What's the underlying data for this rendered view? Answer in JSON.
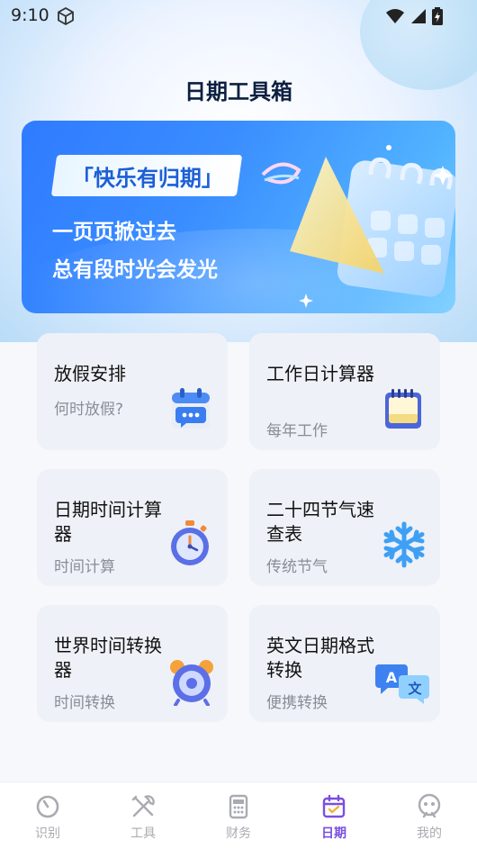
{
  "status": {
    "time": "9:10"
  },
  "header": {
    "title": "日期工具箱"
  },
  "banner": {
    "tag": "「快乐有归期」",
    "line1": "一页页掀过去",
    "line2": "总有段时光会发光"
  },
  "tools": [
    {
      "title": "放假安排",
      "subtitle": "何时放假?",
      "icon": "calendar-chat-icon"
    },
    {
      "title": "工作日计算器",
      "subtitle": "每年工作",
      "icon": "desk-calendar-icon"
    },
    {
      "title": "日期时间计算器",
      "subtitle": "时间计算",
      "icon": "stopwatch-icon"
    },
    {
      "title": "二十四节气速查表",
      "subtitle": "传统节气",
      "icon": "snowflake-icon"
    },
    {
      "title": "世界时间转换器",
      "subtitle": "时间转换",
      "icon": "alarm-clock-icon"
    },
    {
      "title": "英文日期格式转换",
      "subtitle": "便携转换",
      "icon": "translate-icon"
    }
  ],
  "tabbar": {
    "items": [
      {
        "label": "识别",
        "icon": "scan-icon",
        "active": false
      },
      {
        "label": "工具",
        "icon": "tools-icon",
        "active": false
      },
      {
        "label": "财务",
        "icon": "calculator-icon",
        "active": false
      },
      {
        "label": "日期",
        "icon": "calendar-icon",
        "active": true
      },
      {
        "label": "我的",
        "icon": "profile-icon",
        "active": false
      }
    ],
    "active_color": "#7a4fe0"
  },
  "colors": {
    "banner": "#2f7bff",
    "card_bg": "#eef1f7"
  }
}
